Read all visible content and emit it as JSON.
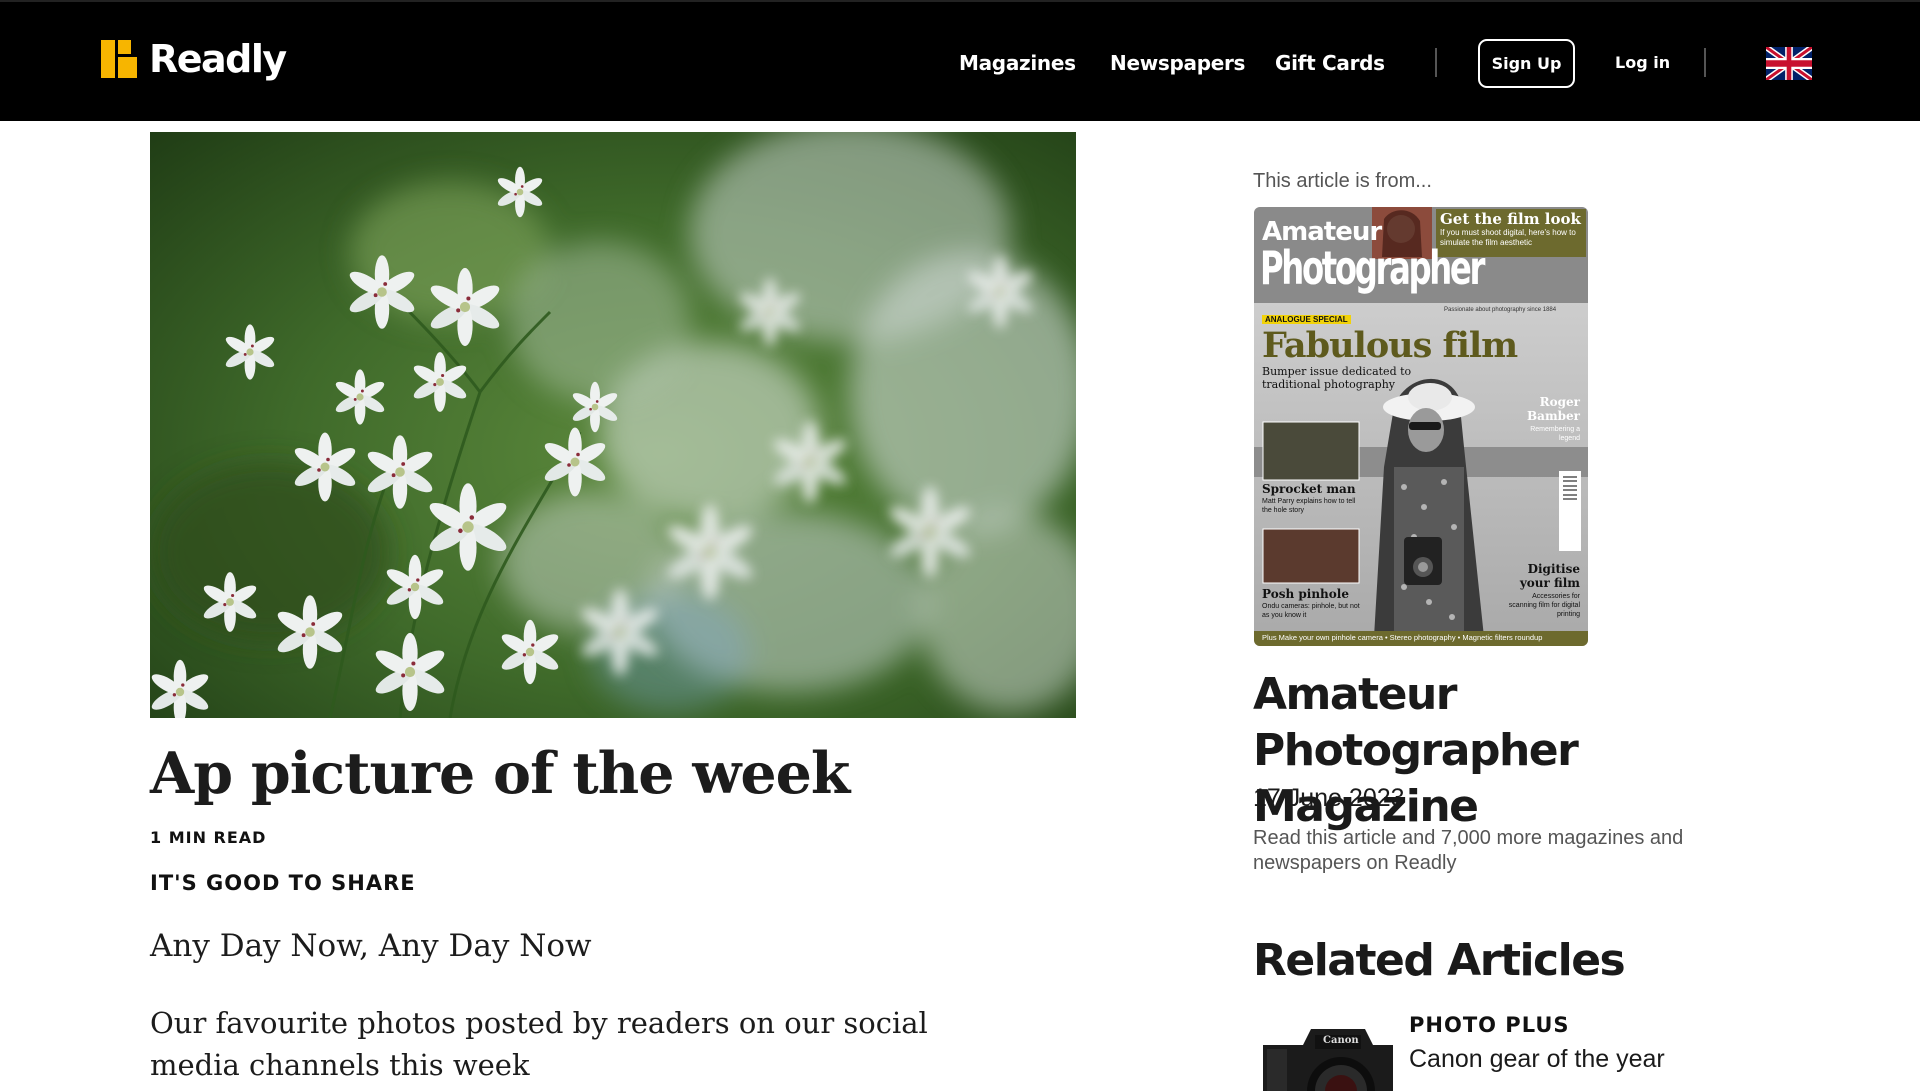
{
  "header": {
    "logo_text": "Readly",
    "nav": {
      "magazines": "Magazines",
      "newspapers": "Newspapers",
      "gift_cards": "Gift Cards"
    },
    "sign_up": "Sign Up",
    "log_in": "Log in",
    "language_flag": "uk-flag-icon",
    "brand_color": "#f7b500"
  },
  "article": {
    "title": "Ap picture of the week",
    "read_time": "1 MIN READ",
    "section": "IT'S GOOD TO SHARE",
    "subtitle": "Any Day Now, Any Day Now",
    "lead": "Our favourite photos posted by readers on our social media channels this week"
  },
  "sidebar": {
    "from_label": "This article is from...",
    "cover": {
      "masthead_top": "Amateur",
      "masthead_main": "Photographer",
      "teaser_head": "Get the film look",
      "teaser_body": "If you must shoot digital, here's how to simulate the film aesthetic",
      "tagline": "Passionate about photography since 1884",
      "badge": "ANALOGUE SPECIAL",
      "headline": "Fabulous film",
      "headline_sub": "Bumper issue dedicated to traditional photography",
      "roger_head": "Roger Bamber",
      "roger_sub": "Remembering a legend",
      "sprocket_head": "Sprocket man",
      "sprocket_sub": "Matt Parry explains how to tell the hole story",
      "pinhole_head": "Posh pinhole",
      "pinhole_sub": "Ondu cameras: pinhole, but not as you know it",
      "digitise_head": "Digitise your film",
      "digitise_sub": "Accessories for scanning film for digital printing",
      "footer": "Plus Make your own pinhole camera • Stereo photography • Magnetic filters roundup"
    },
    "magazine_title": "Amateur Photographer Magazine",
    "date": "17 June 2023",
    "promo": "Read this article and 7,000 more magazines and newspapers on Readly",
    "related_heading": "Related Articles",
    "related": [
      {
        "source": "PHOTO PLUS",
        "title": "Canon gear of the year",
        "thumb_text": "Canon"
      }
    ]
  }
}
